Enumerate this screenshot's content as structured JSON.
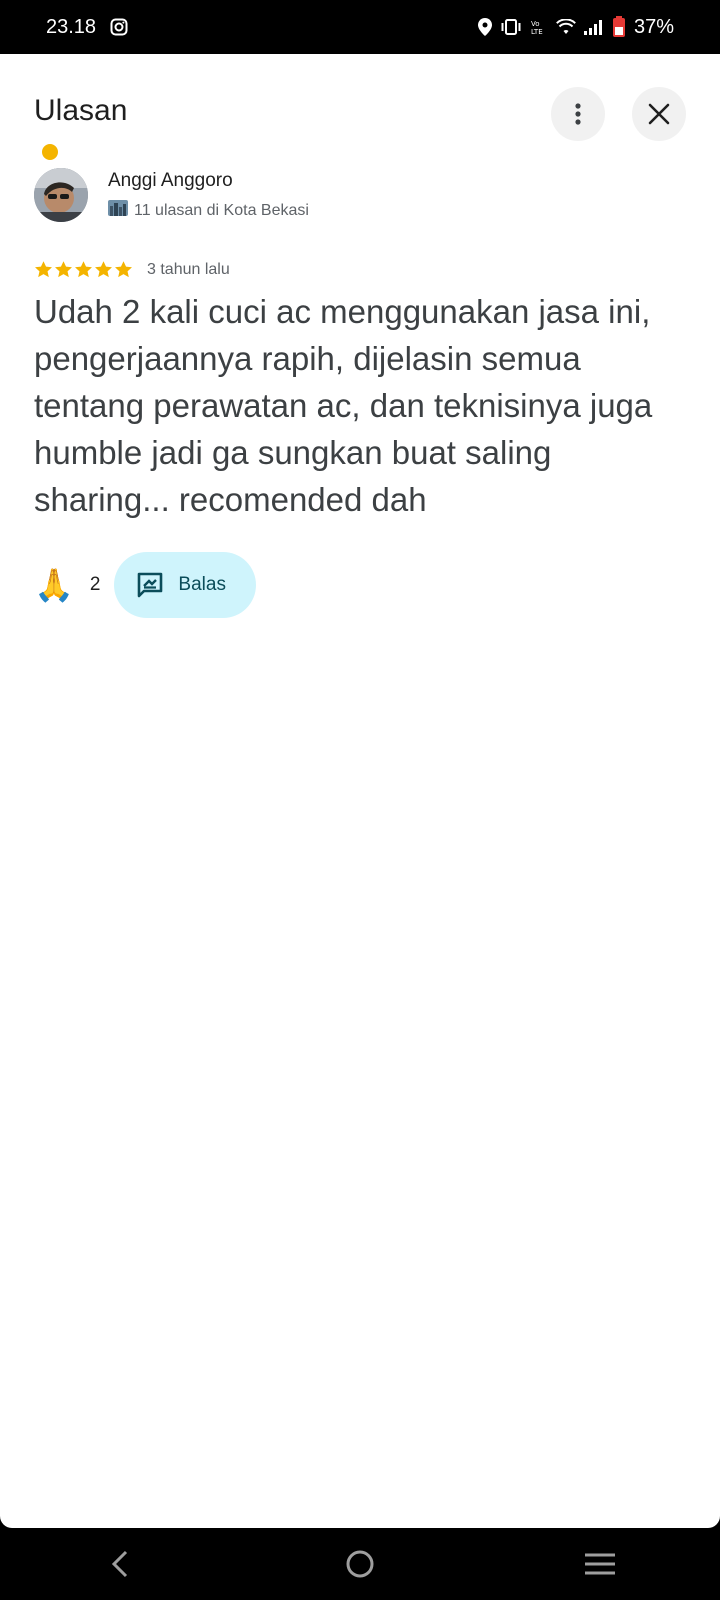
{
  "status_bar": {
    "time": "23.18",
    "battery": "37%",
    "icons": [
      "instagram-icon",
      "location-icon",
      "vibrate-icon",
      "volte-icon",
      "wifi-icon",
      "signal-icon",
      "battery-icon"
    ]
  },
  "header": {
    "title": "Ulasan",
    "more_icon": "more-vert-icon",
    "close_icon": "close-icon"
  },
  "review": {
    "reviewer_name": "Anggi Anggoro",
    "reviewer_meta": "11 ulasan di Kota Bekasi",
    "rating": 5,
    "time": "3 tahun lalu",
    "text": "Udah 2 kali cuci ac menggunakan jasa ini, pengerjaannya rapih, dijelasin semua tentang perawatan ac, dan teknisinya juga humble jadi ga sungkan buat saling sharing... recomended dah",
    "reaction_emoji": "🙏",
    "reaction_count": "2",
    "reply_label": "Balas"
  },
  "colors": {
    "star": "#f4b400",
    "reply_bg": "#cff4fc",
    "reply_text": "#0b4d5a"
  }
}
